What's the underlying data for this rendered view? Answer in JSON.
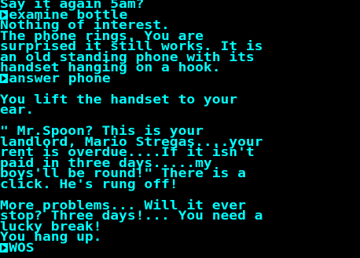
{
  "screen": {
    "text_color": "#00ffff",
    "background_color": "#000000",
    "lines": [
      {
        "text": "Say it again 5am?",
        "prompt": false
      },
      {
        "text": "examine bottle",
        "prompt": true
      },
      {
        "text": "Nothing of interest.",
        "prompt": false
      },
      {
        "text": "The phone rings. You are",
        "prompt": false
      },
      {
        "text": "surprised it still works. It is",
        "prompt": false
      },
      {
        "text": "an old standing phone with its",
        "prompt": false
      },
      {
        "text": "handset hanging on a hook.",
        "prompt": false
      },
      {
        "text": "answer phone",
        "prompt": true
      },
      {
        "text": "",
        "prompt": false
      },
      {
        "text": "You lift the handset to your",
        "prompt": false
      },
      {
        "text": "ear.",
        "prompt": false
      },
      {
        "text": "",
        "prompt": false
      },
      {
        "text": "\" Mr.Spoon? This is your",
        "prompt": false
      },
      {
        "text": "landlord, Mario Stregas....your",
        "prompt": false
      },
      {
        "text": "rent is overdue....If it isn't",
        "prompt": false
      },
      {
        "text": "paid in three days.....my",
        "prompt": false
      },
      {
        "text": "boys'll be round!\" There is a",
        "prompt": false
      },
      {
        "text": "click. He's rung off!",
        "prompt": false
      },
      {
        "text": "",
        "prompt": false
      },
      {
        "text": "More problems... Will it ever",
        "prompt": false
      },
      {
        "text": "stop? Three days!... You need a",
        "prompt": false
      },
      {
        "text": "lucky break!",
        "prompt": false
      },
      {
        "text": "You hang up.",
        "prompt": false
      },
      {
        "text": "WOS",
        "prompt": true
      }
    ]
  }
}
